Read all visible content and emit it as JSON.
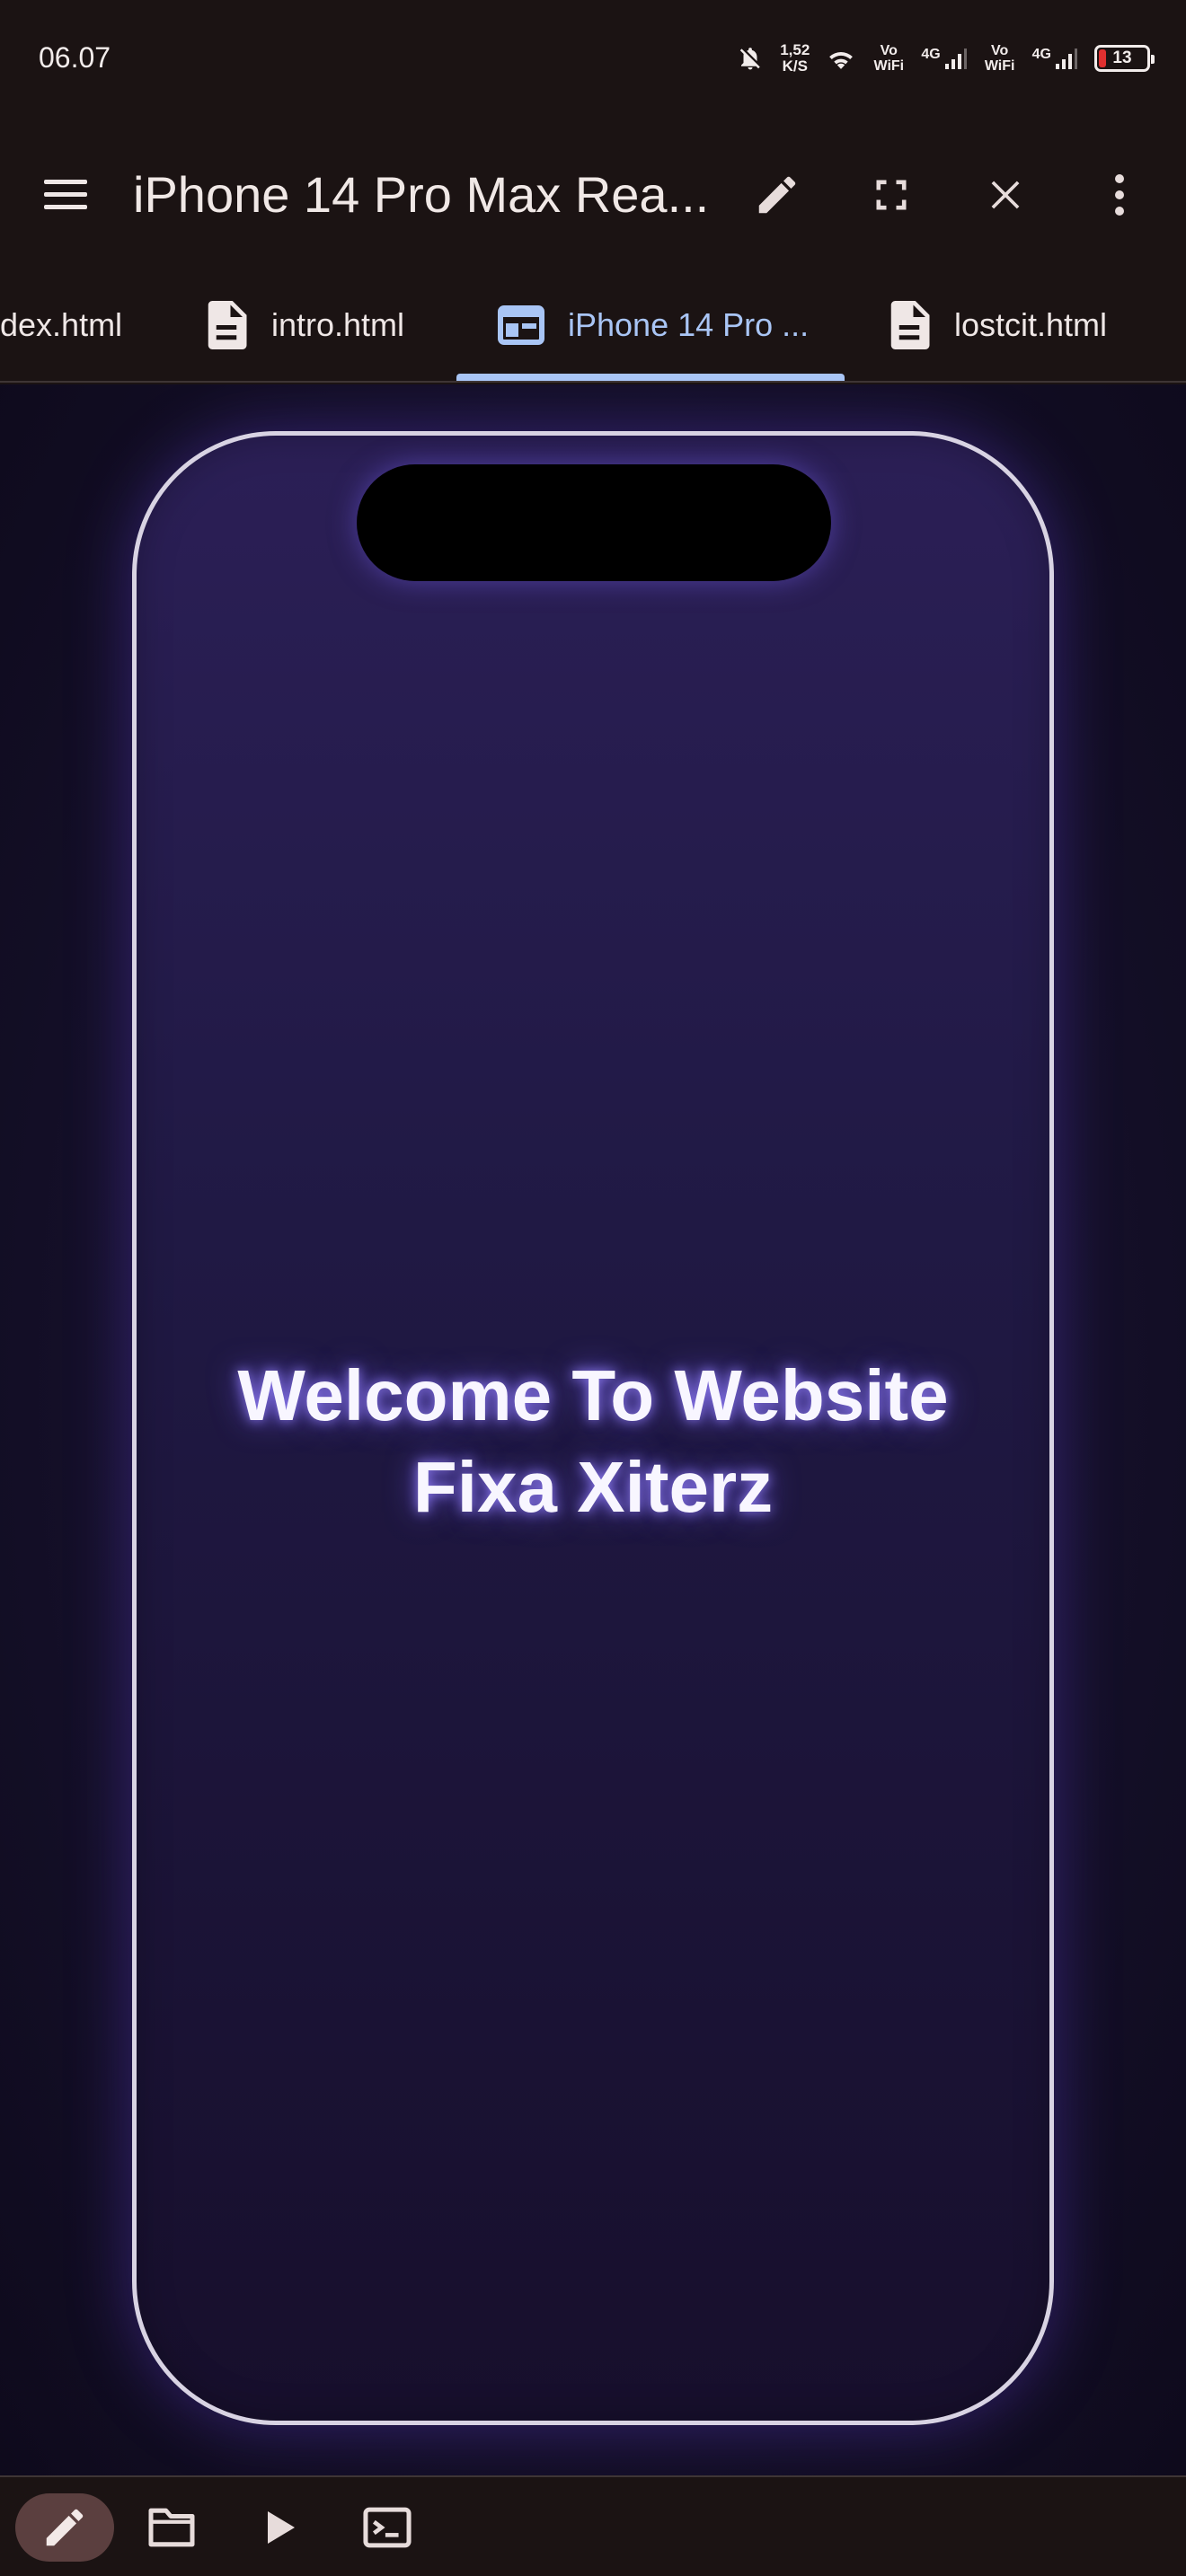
{
  "status_bar": {
    "time": "06.07",
    "net_speed_value": "1,52",
    "net_speed_unit": "K/S",
    "vowifi_1": "Vo WiFi",
    "vowifi_2": "Vo WiFi",
    "network_1": "4G",
    "network_2": "4G",
    "battery_level": "13",
    "icons": [
      "notifications-off-icon",
      "wifi-icon",
      "signal-icon",
      "signal-icon",
      "battery-icon"
    ]
  },
  "app_bar": {
    "title": "iPhone 14 Pro Max Rea...",
    "icons": [
      "menu-icon",
      "edit-icon",
      "fullscreen-icon",
      "close-icon",
      "more-vert-icon"
    ]
  },
  "tabs": [
    {
      "label": "dex.html",
      "icon": "none",
      "active": false
    },
    {
      "label": "intro.html",
      "icon": "document-icon",
      "active": false
    },
    {
      "label": "iPhone 14 Pro ...",
      "icon": "web-preview-icon",
      "active": true
    },
    {
      "label": "lostcit.html",
      "icon": "document-icon",
      "active": false
    }
  ],
  "preview": {
    "welcome_line1": "Welcome To Website",
    "welcome_line2": "Fixa Xiterz"
  },
  "bottom_bar": {
    "icons": [
      "edit-icon",
      "folder-icon",
      "play-icon",
      "terminal-icon"
    ],
    "active": "edit-icon"
  },
  "colors": {
    "chrome_bg": "#1b1313",
    "accent": "#a9c5f5",
    "phone_border": "#d8d3e3",
    "battery_low": "#e03030"
  }
}
